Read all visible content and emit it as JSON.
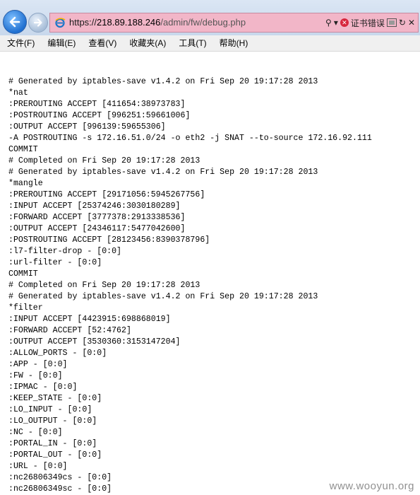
{
  "browser": {
    "url_scheme": "https://",
    "url_host": "218.89.188.246",
    "url_path": "/admin/fw/debug.php",
    "cert_error": "证书错误",
    "search_glyph": "⚲",
    "dropdown_glyph": "▾",
    "refresh_glyph": "↻",
    "close_glyph": "✕"
  },
  "menu": [
    "文件(F)",
    "编辑(E)",
    "查看(V)",
    "收藏夹(A)",
    "工具(T)",
    "帮助(H)"
  ],
  "lines": [
    "# Generated by iptables-save v1.4.2 on Fri Sep 20 19:17:28 2013",
    "*nat",
    ":PREROUTING ACCEPT [411654:38973783]",
    ":POSTROUTING ACCEPT [996251:59661006]",
    ":OUTPUT ACCEPT [996139:59655306]",
    "-A POSTROUTING -s 172.16.51.0/24 -o eth2 -j SNAT --to-source 172.16.92.111",
    "COMMIT",
    "# Completed on Fri Sep 20 19:17:28 2013",
    "# Generated by iptables-save v1.4.2 on Fri Sep 20 19:17:28 2013",
    "*mangle",
    ":PREROUTING ACCEPT [29171056:5945267756]",
    ":INPUT ACCEPT [25374246:3030180289]",
    ":FORWARD ACCEPT [3777378:2913338536]",
    ":OUTPUT ACCEPT [24346117:5477042600]",
    ":POSTROUTING ACCEPT [28123456:8390378796]",
    ":l7-filter-drop - [0:0]",
    ":url-filter - [0:0]",
    "COMMIT",
    "# Completed on Fri Sep 20 19:17:28 2013",
    "# Generated by iptables-save v1.4.2 on Fri Sep 20 19:17:28 2013",
    "*filter",
    ":INPUT ACCEPT [4423915:698868019]",
    ":FORWARD ACCEPT [52:4762]",
    ":OUTPUT ACCEPT [3530360:3153147204]",
    ":ALLOW_PORTS - [0:0]",
    ":APP - [0:0]",
    ":FW - [0:0]",
    ":IPMAC - [0:0]",
    ":KEEP_STATE - [0:0]",
    ":LO_INPUT - [0:0]",
    ":LO_OUTPUT - [0:0]",
    ":NC - [0:0]",
    ":PORTAL_IN - [0:0]",
    ":PORTAL_OUT - [0:0]",
    ":URL - [0:0]",
    ":nc26806349cs - [0:0]",
    ":nc26806349sc - [0:0]"
  ],
  "watermark": "www.wooyun.org"
}
